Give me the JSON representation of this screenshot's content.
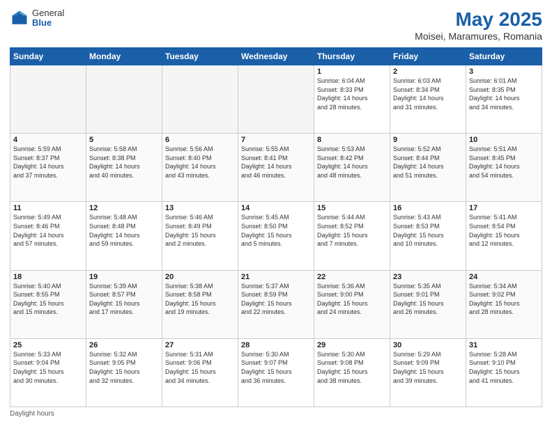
{
  "logo": {
    "general": "General",
    "blue": "Blue"
  },
  "title": "May 2025",
  "subtitle": "Moisei, Maramures, Romania",
  "headers": [
    "Sunday",
    "Monday",
    "Tuesday",
    "Wednesday",
    "Thursday",
    "Friday",
    "Saturday"
  ],
  "footer_note": "Daylight hours",
  "weeks": [
    [
      {
        "day": "",
        "info": ""
      },
      {
        "day": "",
        "info": ""
      },
      {
        "day": "",
        "info": ""
      },
      {
        "day": "",
        "info": ""
      },
      {
        "day": "1",
        "info": "Sunrise: 6:04 AM\nSunset: 8:33 PM\nDaylight: 14 hours\nand 28 minutes."
      },
      {
        "day": "2",
        "info": "Sunrise: 6:03 AM\nSunset: 8:34 PM\nDaylight: 14 hours\nand 31 minutes."
      },
      {
        "day": "3",
        "info": "Sunrise: 6:01 AM\nSunset: 8:35 PM\nDaylight: 14 hours\nand 34 minutes."
      }
    ],
    [
      {
        "day": "4",
        "info": "Sunrise: 5:59 AM\nSunset: 8:37 PM\nDaylight: 14 hours\nand 37 minutes."
      },
      {
        "day": "5",
        "info": "Sunrise: 5:58 AM\nSunset: 8:38 PM\nDaylight: 14 hours\nand 40 minutes."
      },
      {
        "day": "6",
        "info": "Sunrise: 5:56 AM\nSunset: 8:40 PM\nDaylight: 14 hours\nand 43 minutes."
      },
      {
        "day": "7",
        "info": "Sunrise: 5:55 AM\nSunset: 8:41 PM\nDaylight: 14 hours\nand 46 minutes."
      },
      {
        "day": "8",
        "info": "Sunrise: 5:53 AM\nSunset: 8:42 PM\nDaylight: 14 hours\nand 48 minutes."
      },
      {
        "day": "9",
        "info": "Sunrise: 5:52 AM\nSunset: 8:44 PM\nDaylight: 14 hours\nand 51 minutes."
      },
      {
        "day": "10",
        "info": "Sunrise: 5:51 AM\nSunset: 8:45 PM\nDaylight: 14 hours\nand 54 minutes."
      }
    ],
    [
      {
        "day": "11",
        "info": "Sunrise: 5:49 AM\nSunset: 8:46 PM\nDaylight: 14 hours\nand 57 minutes."
      },
      {
        "day": "12",
        "info": "Sunrise: 5:48 AM\nSunset: 8:48 PM\nDaylight: 14 hours\nand 59 minutes."
      },
      {
        "day": "13",
        "info": "Sunrise: 5:46 AM\nSunset: 8:49 PM\nDaylight: 15 hours\nand 2 minutes."
      },
      {
        "day": "14",
        "info": "Sunrise: 5:45 AM\nSunset: 8:50 PM\nDaylight: 15 hours\nand 5 minutes."
      },
      {
        "day": "15",
        "info": "Sunrise: 5:44 AM\nSunset: 8:52 PM\nDaylight: 15 hours\nand 7 minutes."
      },
      {
        "day": "16",
        "info": "Sunrise: 5:43 AM\nSunset: 8:53 PM\nDaylight: 15 hours\nand 10 minutes."
      },
      {
        "day": "17",
        "info": "Sunrise: 5:41 AM\nSunset: 8:54 PM\nDaylight: 15 hours\nand 12 minutes."
      }
    ],
    [
      {
        "day": "18",
        "info": "Sunrise: 5:40 AM\nSunset: 8:55 PM\nDaylight: 15 hours\nand 15 minutes."
      },
      {
        "day": "19",
        "info": "Sunrise: 5:39 AM\nSunset: 8:57 PM\nDaylight: 15 hours\nand 17 minutes."
      },
      {
        "day": "20",
        "info": "Sunrise: 5:38 AM\nSunset: 8:58 PM\nDaylight: 15 hours\nand 19 minutes."
      },
      {
        "day": "21",
        "info": "Sunrise: 5:37 AM\nSunset: 8:59 PM\nDaylight: 15 hours\nand 22 minutes."
      },
      {
        "day": "22",
        "info": "Sunrise: 5:36 AM\nSunset: 9:00 PM\nDaylight: 15 hours\nand 24 minutes."
      },
      {
        "day": "23",
        "info": "Sunrise: 5:35 AM\nSunset: 9:01 PM\nDaylight: 15 hours\nand 26 minutes."
      },
      {
        "day": "24",
        "info": "Sunrise: 5:34 AM\nSunset: 9:02 PM\nDaylight: 15 hours\nand 28 minutes."
      }
    ],
    [
      {
        "day": "25",
        "info": "Sunrise: 5:33 AM\nSunset: 9:04 PM\nDaylight: 15 hours\nand 30 minutes."
      },
      {
        "day": "26",
        "info": "Sunrise: 5:32 AM\nSunset: 9:05 PM\nDaylight: 15 hours\nand 32 minutes."
      },
      {
        "day": "27",
        "info": "Sunrise: 5:31 AM\nSunset: 9:06 PM\nDaylight: 15 hours\nand 34 minutes."
      },
      {
        "day": "28",
        "info": "Sunrise: 5:30 AM\nSunset: 9:07 PM\nDaylight: 15 hours\nand 36 minutes."
      },
      {
        "day": "29",
        "info": "Sunrise: 5:30 AM\nSunset: 9:08 PM\nDaylight: 15 hours\nand 38 minutes."
      },
      {
        "day": "30",
        "info": "Sunrise: 5:29 AM\nSunset: 9:09 PM\nDaylight: 15 hours\nand 39 minutes."
      },
      {
        "day": "31",
        "info": "Sunrise: 5:28 AM\nSunset: 9:10 PM\nDaylight: 15 hours\nand 41 minutes."
      }
    ]
  ]
}
